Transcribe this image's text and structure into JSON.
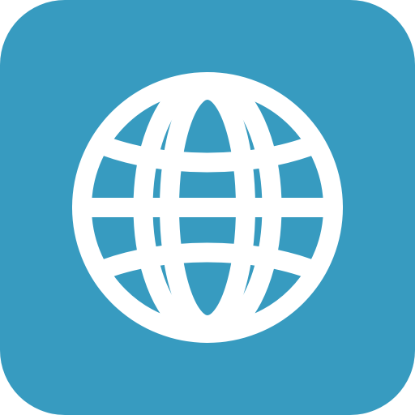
{
  "app_icon": {
    "icon": "globe-icon",
    "background_color": "#379bc0",
    "glyph_color": "#ffffff"
  }
}
